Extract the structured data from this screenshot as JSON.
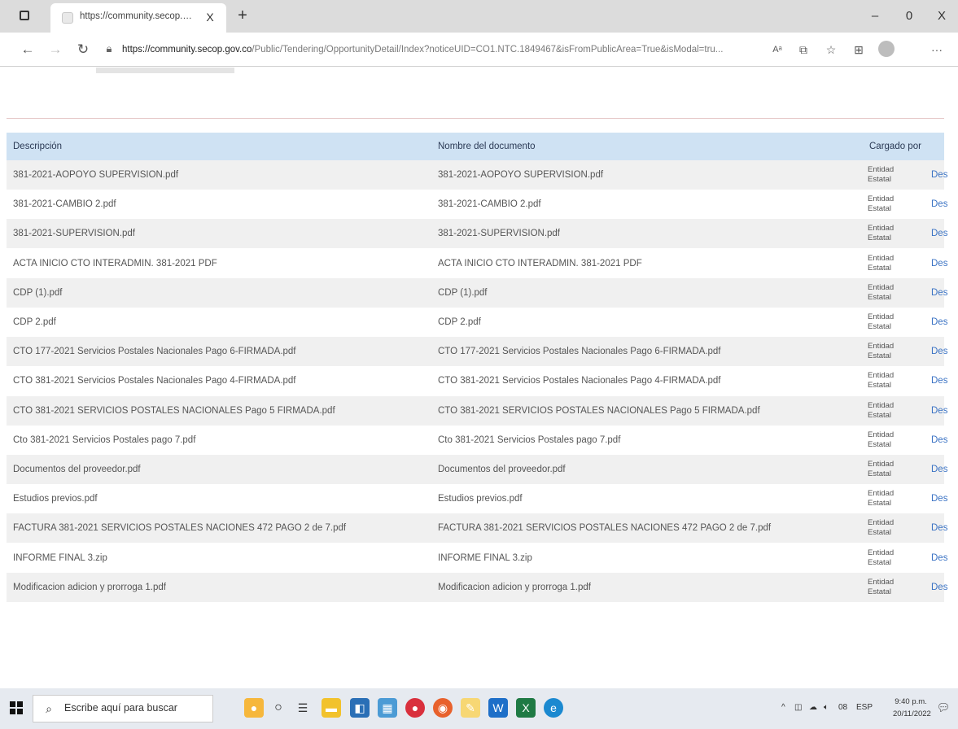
{
  "browser": {
    "tab_title": "https://community.secop.gov.co",
    "tab_close": "X",
    "new_tab": "+",
    "address_host": "https://community.secop.gov.co",
    "address_path": "/Public/Tendering/OpportunityDetail/Index?noticeUID=CO1.NTC.1849467&isFromPublicArea=True&isModal=tru...",
    "win_minimize": "–",
    "win_restore": "0",
    "win_close": "X"
  },
  "table": {
    "headers": {
      "description": "Descripción",
      "document_name": "Nombre del documento",
      "uploaded_by": "Cargado por"
    },
    "rows": [
      {
        "description": "381-2021-AOPOYO SUPERVISION.pdf",
        "document": "381-2021-AOPOYO SUPERVISION.pdf",
        "uploaded_by_1": "Entidad",
        "uploaded_by_2": "Estatal",
        "action": "Desc"
      },
      {
        "description": "381-2021-CAMBIO 2.pdf",
        "document": "381-2021-CAMBIO 2.pdf",
        "uploaded_by_1": "Entidad",
        "uploaded_by_2": "Estatal",
        "action": "Desc"
      },
      {
        "description": "381-2021-SUPERVISION.pdf",
        "document": "381-2021-SUPERVISION.pdf",
        "uploaded_by_1": "Entidad",
        "uploaded_by_2": "Estatal",
        "action": "Desc"
      },
      {
        "description": "ACTA INICIO CTO INTERADMIN. 381-2021 PDF",
        "document": "ACTA INICIO CTO INTERADMIN. 381-2021 PDF",
        "uploaded_by_1": "Entidad",
        "uploaded_by_2": "Estatal",
        "action": "Desc"
      },
      {
        "description": "CDP (1).pdf",
        "document": "CDP (1).pdf",
        "uploaded_by_1": "Entidad",
        "uploaded_by_2": "Estatal",
        "action": "Desc"
      },
      {
        "description": "CDP 2.pdf",
        "document": "CDP 2.pdf",
        "uploaded_by_1": "Entidad",
        "uploaded_by_2": "Estatal",
        "action": "Desc"
      },
      {
        "description": "CTO 177-2021 Servicios Postales Nacionales Pago 6-FIRMADA.pdf",
        "document": "CTO 177-2021 Servicios Postales Nacionales Pago 6-FIRMADA.pdf",
        "uploaded_by_1": "Entidad",
        "uploaded_by_2": "Estatal",
        "action": "Desc"
      },
      {
        "description": "CTO 381-2021 Servicios Postales Nacionales Pago 4-FIRMADA.pdf",
        "document": "CTO 381-2021 Servicios Postales Nacionales Pago 4-FIRMADA.pdf",
        "uploaded_by_1": "Entidad",
        "uploaded_by_2": "Estatal",
        "action": "Desc"
      },
      {
        "description": "CTO 381-2021 SERVICIOS POSTALES NACIONALES Pago 5 FIRMADA.pdf",
        "document": "CTO 381-2021 SERVICIOS POSTALES NACIONALES Pago 5 FIRMADA.pdf",
        "uploaded_by_1": "Entidad",
        "uploaded_by_2": "Estatal",
        "action": "Desc"
      },
      {
        "description": "Cto 381-2021 Servicios Postales pago 7.pdf",
        "document": "Cto 381-2021 Servicios Postales pago 7.pdf",
        "uploaded_by_1": "Entidad",
        "uploaded_by_2": "Estatal",
        "action": "Desc"
      },
      {
        "description": "Documentos del proveedor.pdf",
        "document": "Documentos del proveedor.pdf",
        "uploaded_by_1": "Entidad",
        "uploaded_by_2": "Estatal",
        "action": "Desc"
      },
      {
        "description": "Estudios previos.pdf",
        "document": "Estudios previos.pdf",
        "uploaded_by_1": "Entidad",
        "uploaded_by_2": "Estatal",
        "action": "Desc"
      },
      {
        "description": "FACTURA 381-2021 SERVICIOS POSTALES NACIONES 472 PAGO 2 de 7.pdf",
        "document": "FACTURA 381-2021 SERVICIOS POSTALES NACIONES 472 PAGO 2 de 7.pdf",
        "uploaded_by_1": "Entidad",
        "uploaded_by_2": "Estatal",
        "action": "Desc"
      },
      {
        "description": "INFORME FINAL 3.zip",
        "document": "INFORME FINAL 3.zip",
        "uploaded_by_1": "Entidad",
        "uploaded_by_2": "Estatal",
        "action": "Desc"
      },
      {
        "description": "Modificacion adicion y prorroga 1.pdf",
        "document": "Modificacion adicion y prorroga 1.pdf",
        "uploaded_by_1": "Entidad",
        "uploaded_by_2": "Estatal",
        "action": "Desc"
      }
    ]
  },
  "taskbar": {
    "search_placeholder": "Escribe aquí para buscar",
    "tray_lang": "ESP",
    "tray_temp": "08",
    "clock_time": "9:40 p.m.",
    "clock_date": "20/11/2022"
  },
  "colors": {
    "header_bg": "#cfe2f3",
    "row_alt_bg": "#f0f0f0",
    "link": "#3b73c4",
    "taskbar_bg": "#e6eaf0"
  }
}
